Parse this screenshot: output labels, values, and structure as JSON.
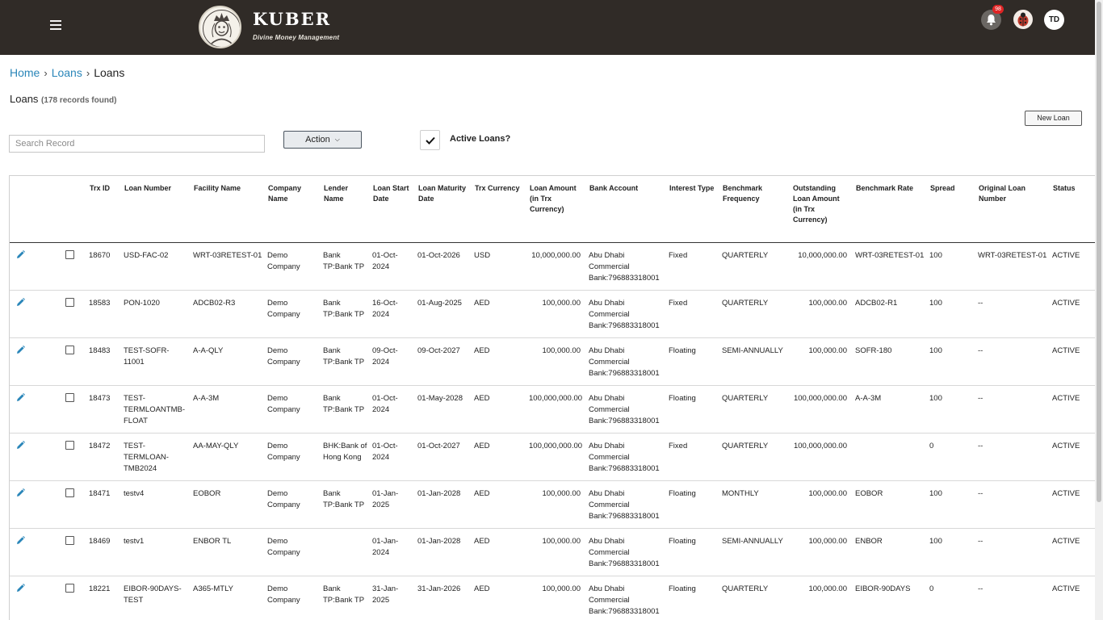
{
  "header": {
    "brand_name": "KUBER",
    "brand_tagline": "Divine Money Management",
    "notification_count": "98",
    "user_initials": "TD"
  },
  "breadcrumb": {
    "home": "Home",
    "loans_link": "Loans",
    "current": "Loans"
  },
  "page": {
    "title": "Loans",
    "record_count": "(178 records found)",
    "new_loan_label": "New Loan"
  },
  "toolbar": {
    "search_placeholder": "Search Record",
    "action_label": "Action",
    "active_loans_label": "Active Loans?",
    "active_loans_checked": true
  },
  "table": {
    "columns": [
      "",
      "",
      "Trx ID",
      "Loan Number",
      "Facility Name",
      "Company Name",
      "Lender Name",
      "Loan Start Date",
      "Loan Maturity Date",
      "Trx Currency",
      "Loan Amount (in Trx Currency)",
      "Bank Account",
      "Interest Type",
      "Benchmark Frequency",
      "Outstanding Loan Amount (in Trx Currency)",
      "Benchmark Rate",
      "Spread",
      "Original Loan Number",
      "Status"
    ],
    "rows": [
      {
        "trx_id": "18670",
        "loan_number": "USD-FAC-02",
        "facility": "WRT-03RETEST-01",
        "company": "Demo Company",
        "lender": "Bank TP:Bank TP",
        "start": "01-Oct-2024",
        "maturity": "01-Oct-2026",
        "currency": "USD",
        "amount": "10,000,000.00",
        "bank_account": "Abu Dhabi Commercial Bank:796883318001",
        "interest_type": "Fixed",
        "frequency": "QUARTERLY",
        "outstanding": "10,000,000.00",
        "benchmark_rate": "WRT-03RETEST-01",
        "spread": "100",
        "original": "WRT-03RETEST-01",
        "status": "ACTIVE"
      },
      {
        "trx_id": "18583",
        "loan_number": "PON-1020",
        "facility": "ADCB02-R3",
        "company": "Demo Company",
        "lender": "Bank TP:Bank TP",
        "start": "16-Oct-2024",
        "maturity": "01-Aug-2025",
        "currency": "AED",
        "amount": "100,000.00",
        "bank_account": "Abu Dhabi Commercial Bank:796883318001",
        "interest_type": "Fixed",
        "frequency": "QUARTERLY",
        "outstanding": "100,000.00",
        "benchmark_rate": "ADCB02-R1",
        "spread": "100",
        "original": "--",
        "status": "ACTIVE"
      },
      {
        "trx_id": "18483",
        "loan_number": "TEST-SOFR-11001",
        "facility": "A-A-QLY",
        "company": "Demo Company",
        "lender": "Bank TP:Bank TP",
        "start": "09-Oct-2024",
        "maturity": "09-Oct-2027",
        "currency": "AED",
        "amount": "100,000.00",
        "bank_account": "Abu Dhabi Commercial Bank:796883318001",
        "interest_type": "Floating",
        "frequency": "SEMI-ANNUALLY",
        "outstanding": "100,000.00",
        "benchmark_rate": "SOFR-180",
        "spread": "100",
        "original": "--",
        "status": "ACTIVE"
      },
      {
        "trx_id": "18473",
        "loan_number": "TEST-TERMLOANTMB-FLOAT",
        "facility": "A-A-3M",
        "company": "Demo Company",
        "lender": "Bank TP:Bank TP",
        "start": "01-Oct-2024",
        "maturity": "01-May-2028",
        "currency": "AED",
        "amount": "100,000,000.00",
        "bank_account": "Abu Dhabi Commercial Bank:796883318001",
        "interest_type": "Floating",
        "frequency": "QUARTERLY",
        "outstanding": "100,000,000.00",
        "benchmark_rate": "A-A-3M",
        "spread": "100",
        "original": "--",
        "status": "ACTIVE"
      },
      {
        "trx_id": "18472",
        "loan_number": "TEST-TERMLOAN-TMB2024",
        "facility": "AA-MAY-QLY",
        "company": "Demo Company",
        "lender": "BHK:Bank of Hong Kong",
        "start": "01-Oct-2024",
        "maturity": "01-Oct-2027",
        "currency": "AED",
        "amount": "100,000,000.00",
        "bank_account": "Abu Dhabi Commercial Bank:796883318001",
        "interest_type": "Fixed",
        "frequency": "QUARTERLY",
        "outstanding": "100,000,000.00",
        "benchmark_rate": "",
        "spread": "0",
        "original": "--",
        "status": "ACTIVE"
      },
      {
        "trx_id": "18471",
        "loan_number": "testv4",
        "facility": "EOBOR",
        "company": "Demo Company",
        "lender": "Bank TP:Bank TP",
        "start": "01-Jan-2025",
        "maturity": "01-Jan-2028",
        "currency": "AED",
        "amount": "100,000.00",
        "bank_account": "Abu Dhabi Commercial Bank:796883318001",
        "interest_type": "Floating",
        "frequency": "MONTHLY",
        "outstanding": "100,000.00",
        "benchmark_rate": "EOBOR",
        "spread": "100",
        "original": "--",
        "status": "ACTIVE"
      },
      {
        "trx_id": "18469",
        "loan_number": "testv1",
        "facility": "ENBOR TL",
        "company": "Demo Company",
        "lender": "",
        "start": "01-Jan-2024",
        "maturity": "01-Jan-2028",
        "currency": "AED",
        "amount": "100,000.00",
        "bank_account": "Abu Dhabi Commercial Bank:796883318001",
        "interest_type": "Floating",
        "frequency": "SEMI-ANNUALLY",
        "outstanding": "100,000.00",
        "benchmark_rate": "ENBOR",
        "spread": "100",
        "original": "--",
        "status": "ACTIVE"
      },
      {
        "trx_id": "18221",
        "loan_number": "EIBOR-90DAYS-TEST",
        "facility": "A365-MTLY",
        "company": "Demo Company",
        "lender": "Bank TP:Bank TP",
        "start": "31-Jan-2025",
        "maturity": "31-Jan-2026",
        "currency": "AED",
        "amount": "100,000.00",
        "bank_account": "Abu Dhabi Commercial Bank:796883318001",
        "interest_type": "Floating",
        "frequency": "QUARTERLY",
        "outstanding": "100,000.00",
        "benchmark_rate": "EIBOR-90DAYS",
        "spread": "0",
        "original": "--",
        "status": "ACTIVE"
      }
    ]
  },
  "colors": {
    "header_bg": "#302b27",
    "link": "#2a86b9",
    "edit_icon": "#2a86b9",
    "badge": "#e02424"
  },
  "icons": {
    "menu": "hamburger-icon",
    "bell": "bell-icon",
    "edit": "pencil-icon",
    "check": "check-icon"
  }
}
